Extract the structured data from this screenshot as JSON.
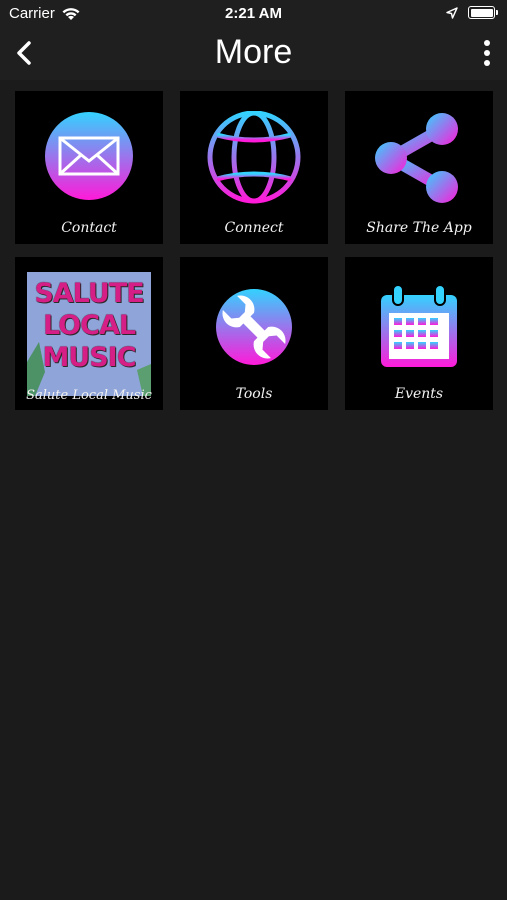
{
  "status_bar": {
    "carrier": "Carrier",
    "time": "2:21 AM"
  },
  "nav": {
    "title": "More"
  },
  "tiles": [
    {
      "label": "Contact",
      "icon": "mail-icon"
    },
    {
      "label": "Connect",
      "icon": "globe-icon"
    },
    {
      "label": "Share The App",
      "icon": "share-icon"
    },
    {
      "label": "Salute Local Music",
      "icon": "salute-local-music-logo",
      "logo_lines": [
        "SALUTE",
        "LOCAL",
        "MUSIC"
      ]
    },
    {
      "label": "Tools",
      "icon": "wrench-icon"
    },
    {
      "label": "Events",
      "icon": "calendar-icon"
    }
  ],
  "colors": {
    "background": "#1b1b1c",
    "tile_background": "#000000",
    "gradient_start": "#33d2ff",
    "gradient_end": "#ff1ad9"
  }
}
